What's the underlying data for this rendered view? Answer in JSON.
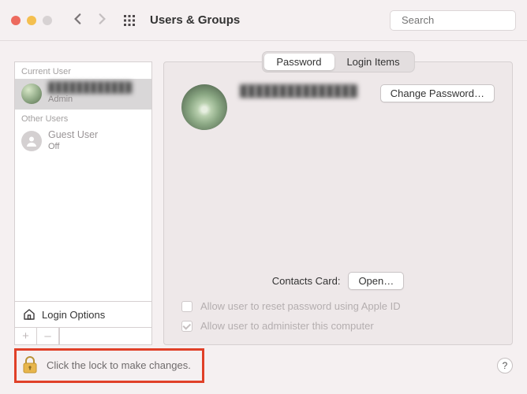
{
  "toolbar": {
    "title": "Users & Groups",
    "search_placeholder": "Search"
  },
  "sidebar": {
    "current_label": "Current User",
    "other_label": "Other Users",
    "current_user": {
      "name": "████████████",
      "role": "Admin"
    },
    "guest_user": {
      "name": "Guest User",
      "role": "Off"
    },
    "login_options": "Login Options",
    "add_label": "+",
    "remove_label": "–"
  },
  "tabs": {
    "password": "Password",
    "login_items": "Login Items"
  },
  "main": {
    "display_name": "███████████████",
    "change_password": "Change Password…",
    "contacts_label": "Contacts Card:",
    "open_label": "Open…",
    "reset_apple_id": "Allow user to reset password using Apple ID",
    "administer": "Allow user to administer this computer"
  },
  "footer": {
    "lock_text": "Click the lock to make changes.",
    "help_label": "?"
  }
}
